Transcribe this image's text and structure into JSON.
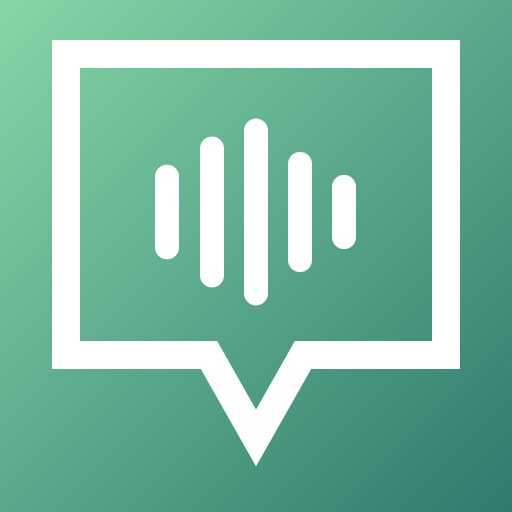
{
  "app_icon": {
    "icon": "voice-message-icon",
    "background": {
      "gradient_start": "#86D6A6",
      "gradient_end": "#2E7A6E"
    },
    "speech_bubble": {
      "icon": "speech-bubble-icon",
      "stroke_color": "#FFFFFF"
    },
    "waveform": {
      "icon": "audio-waveform-icon",
      "color": "#FFFFFF",
      "bar_levels": [
        0.37,
        0.59,
        0.73,
        0.47,
        0.29
      ]
    }
  }
}
